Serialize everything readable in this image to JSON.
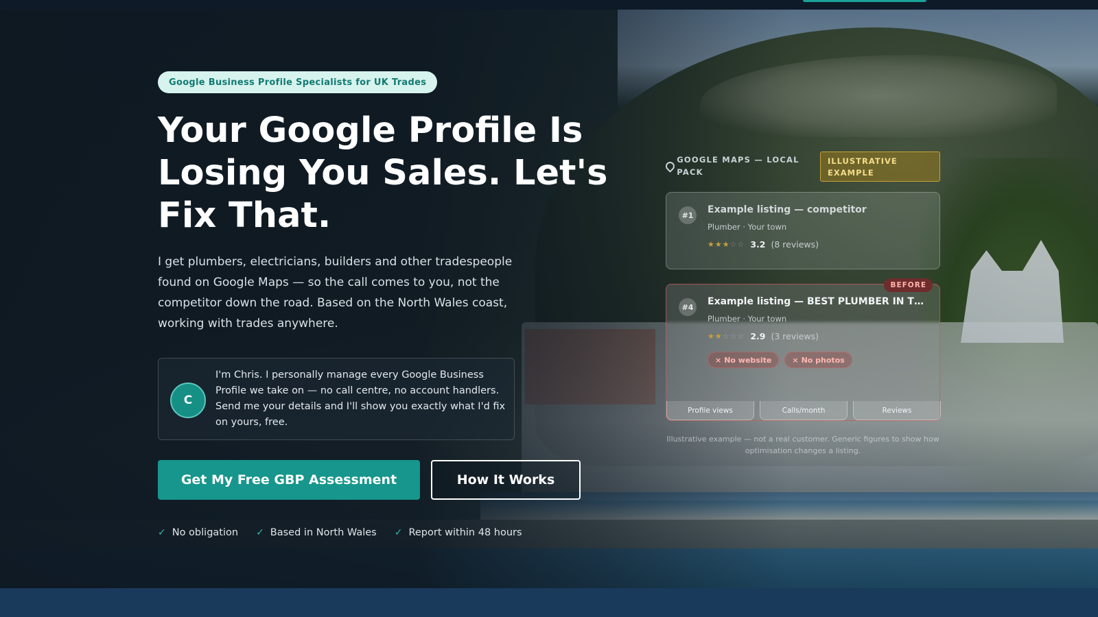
{
  "hero": {
    "badge": "Google Business Profile Specialists for UK Trades",
    "headline": "Your Google Profile Is Losing You Sales. Let's Fix That.",
    "subcopy": "I get plumbers, electricians, builders and other tradespeople found on Google Maps — so the call comes to you, not the competitor down the road. Based on the North Wales coast, working with trades anywhere.",
    "intro": {
      "avatar_initial": "C",
      "text": "I'm Chris. I personally manage every Google Business Profile we take on — no call centre, no account handlers. Send me your details and I'll show you exactly what I'd fix on yours, free."
    },
    "primary_cta": "Get My Free GBP Assessment",
    "secondary_cta": "How It Works",
    "assurances": [
      "No obligation",
      "Based in North Wales",
      "Report within 48 hours"
    ],
    "check_icon": "check-icon"
  },
  "widget": {
    "header_label": "GOOGLE MAPS — LOCAL PACK",
    "tag": "ILLUSTRATIVE EXAMPLE",
    "competitor": {
      "rank": "#1",
      "name": "Example listing — competitor",
      "meta": "Plumber · Your town",
      "stars_filled": 3,
      "stars_total": 5,
      "rating": "3.2",
      "reviews": "(8 reviews)"
    },
    "before": {
      "tag": "BEFORE",
      "rank": "#4",
      "name": "Example listing — BEST PLUMBER IN TOWN",
      "meta": "Plumber · Your town",
      "stars_filled": 2,
      "stars_total": 5,
      "rating": "2.9",
      "reviews": "(3 reviews)",
      "issues": [
        "No website",
        "No photos"
      ],
      "stats": [
        "Profile views",
        "Calls/month",
        "Reviews"
      ]
    },
    "disclaimer": "Illustrative example — not a real customer. Generic figures to show how optimisation changes a listing."
  },
  "colors": {
    "accent": "#16968c",
    "badge_bg": "#d7f3ee",
    "badge_text": "#127a72",
    "before_red": "#ffb3ad",
    "illustrative_gold": "#f4dc8a"
  }
}
